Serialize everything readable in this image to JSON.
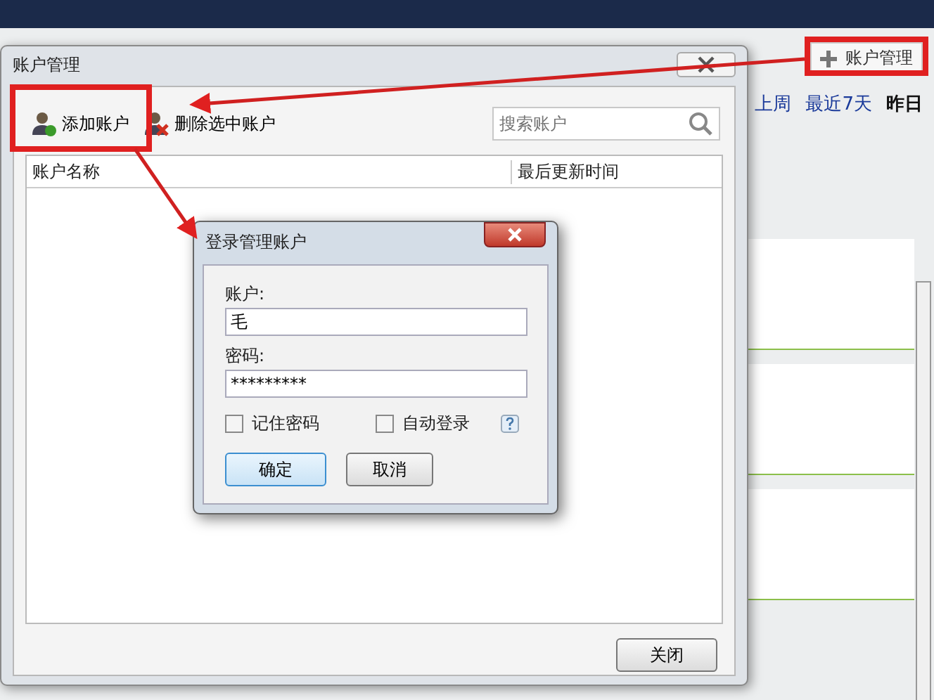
{
  "header_button": {
    "label": "账户管理"
  },
  "date_tabs": [
    {
      "label": "上周",
      "selected": false
    },
    {
      "label": "最近7天",
      "selected": false
    },
    {
      "label": "昨日",
      "selected": true
    }
  ],
  "account_dialog": {
    "title": "账户管理",
    "toolbar": [
      {
        "label": "添加账户",
        "kind": "add"
      },
      {
        "label": "删除选中账户",
        "kind": "delete"
      }
    ],
    "search": {
      "placeholder": "搜索账户"
    },
    "table": {
      "columns": [
        "账户名称",
        "最后更新时间"
      ]
    },
    "buttons": [
      "关闭"
    ]
  },
  "login_dialog": {
    "title": "登录管理账户",
    "fields": [
      {
        "label": "账户:",
        "value": "毛"
      },
      {
        "label": "密码:",
        "value": "*********"
      }
    ],
    "options": [
      {
        "label": "记住密码",
        "checked": false
      },
      {
        "label": "自动登录",
        "checked": false
      }
    ],
    "buttons": [
      {
        "label": "确定",
        "selected": true
      },
      {
        "label": "取消",
        "selected": false
      }
    ]
  }
}
